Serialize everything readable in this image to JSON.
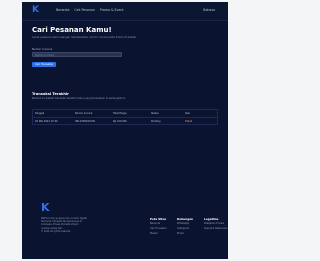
{
  "nav": {
    "logo_text": "K",
    "links": [
      "Beranda",
      "Cek Pesanan",
      "Promo & Event"
    ],
    "right_label": "Bahasa"
  },
  "hero": {
    "title": "Cari Pesanan Kamu!",
    "subtitle": "Lacak pesanan kamu dengan memasukkan nomor invoice pada kolom di bawah",
    "field_label": "Nomor Invoice",
    "input_placeholder": "Nomor Invoice",
    "button_label": "Cari Transaksi"
  },
  "results": {
    "title": "Transaksi Terakhir",
    "subtitle": "Berikut ini adalah transaksi terakhir kamu yang tersimpan di perangkat ini",
    "headers": [
      "Tanggal",
      "Nomor Invoice",
      "Total Harga",
      "Status",
      "Aksi"
    ],
    "row": [
      "20 Mei 2024 10:30",
      "INV-2405201030",
      "Rp 150.000",
      "Pending",
      "Detail"
    ]
  },
  "footer": {
    "logo_text": "K",
    "description": [
      "Platform top up game dan voucher digital",
      "termurah, tercepat dan terpercaya di",
      "Indonesia. Proses otomatis 24 jam",
      "nonstop setiap hari.",
      "© 2024 All rights reserved."
    ],
    "columns": [
      {
        "title": "Peta Situs",
        "links": [
          "Beranda",
          "Cek Transaksi",
          "Masuk"
        ]
      },
      {
        "title": "Dukungan",
        "links": [
          "WhatsApp",
          "Instagram",
          "Email"
        ]
      },
      {
        "title": "Legalitas",
        "links": [
          "Kebijakan Privasi",
          "Syarat & Ketentuan"
        ]
      }
    ]
  },
  "colors": {
    "background": "#0a1430",
    "accent": "#2f6fe8",
    "status_pending": "#f2b01e"
  }
}
